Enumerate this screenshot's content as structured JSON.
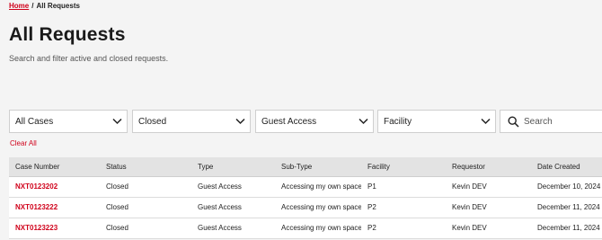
{
  "breadcrumb": {
    "home": "Home",
    "separator": "/",
    "current": "All Requests"
  },
  "page": {
    "title": "All Requests",
    "subtitle": "Search and filter active and closed requests."
  },
  "filters": {
    "cases": {
      "value": "All Cases"
    },
    "status": {
      "value": "Closed"
    },
    "type": {
      "value": "Guest Access"
    },
    "facility": {
      "value": "Facility"
    },
    "search": {
      "placeholder": "Search",
      "value": ""
    },
    "clear_all": "Clear All"
  },
  "table": {
    "headers": {
      "case_number": "Case Number",
      "status": "Status",
      "type": "Type",
      "sub_type": "Sub-Type",
      "facility": "Facility",
      "requestor": "Requestor",
      "date_created": "Date Created"
    },
    "rows": [
      {
        "case_number": "NXT0123202",
        "status": "Closed",
        "type": "Guest Access",
        "sub_type": "Accessing my own space",
        "facility": "P1",
        "requestor": "Kevin DEV",
        "date_created": "December 10, 2024"
      },
      {
        "case_number": "NXT0123222",
        "status": "Closed",
        "type": "Guest Access",
        "sub_type": "Accessing my own space",
        "facility": "P2",
        "requestor": "Kevin DEV",
        "date_created": "December 11, 2024"
      },
      {
        "case_number": "NXT0123223",
        "status": "Closed",
        "type": "Guest Access",
        "sub_type": "Accessing my own space",
        "facility": "P2",
        "requestor": "Kevin DEV",
        "date_created": "December 11, 2024"
      }
    ]
  },
  "colors": {
    "accent": "#d0021b",
    "background": "#f4f4f4",
    "header_row": "#e3e3e3"
  }
}
